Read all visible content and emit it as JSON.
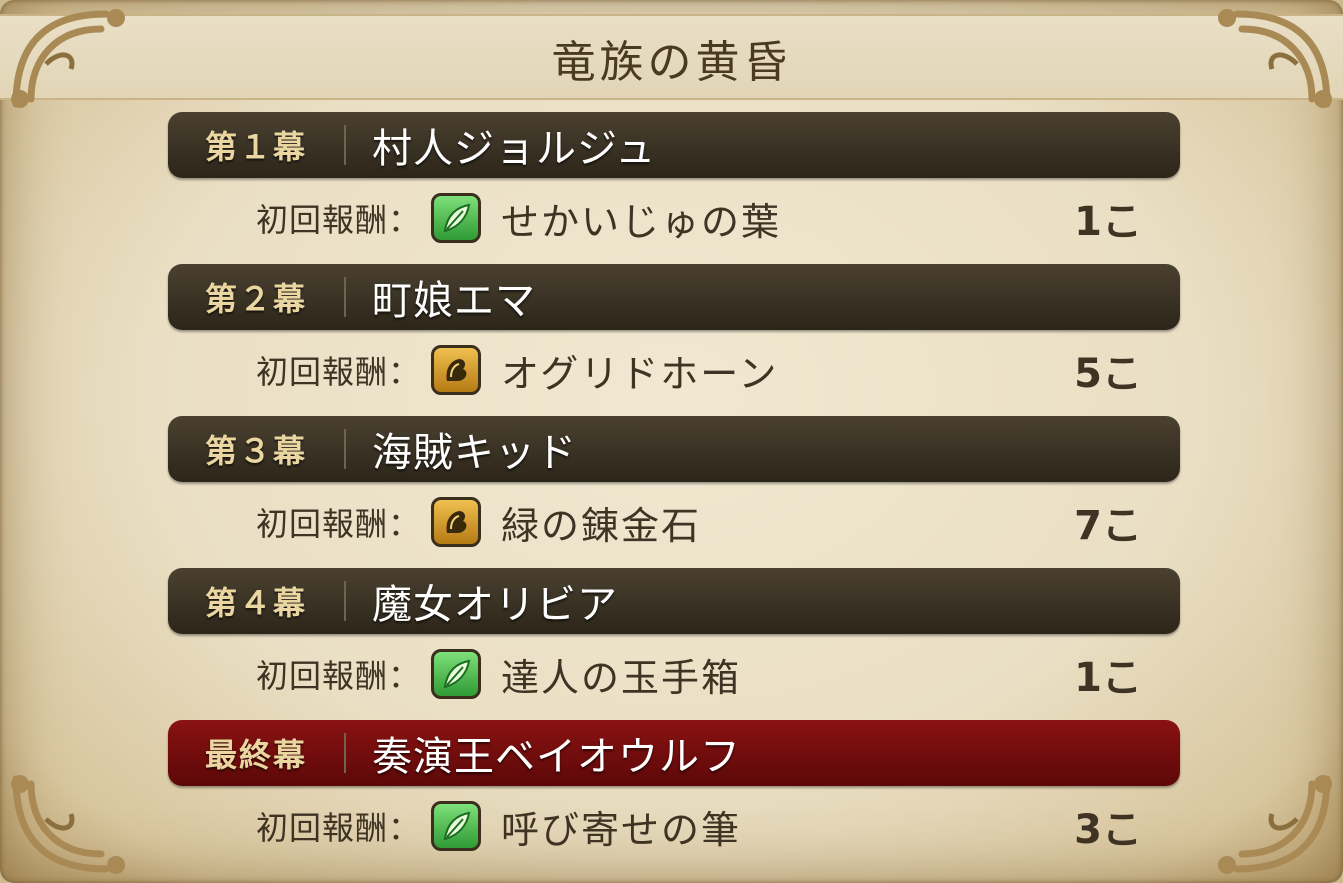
{
  "title": "竜族の黄昏",
  "reward_label": "初回報酬：",
  "colors": {
    "chapter_bar": "#2c2519",
    "final_bar": "#6a0a0a",
    "background": "#eadfc4",
    "icon_leaf": "#3fae3f",
    "icon_horn": "#c98f1e"
  },
  "chapters": [
    {
      "act": "第１幕",
      "name": "村人ジョルジュ",
      "item": "せかいじゅの葉",
      "icon": "leaf-icon",
      "count": "1こ",
      "final": false
    },
    {
      "act": "第２幕",
      "name": "町娘エマ",
      "item": "オグリドホーン",
      "icon": "horn-icon",
      "count": "5こ",
      "final": false
    },
    {
      "act": "第３幕",
      "name": "海賊キッド",
      "item": "緑の錬金石",
      "icon": "horn-icon",
      "count": "7こ",
      "final": false
    },
    {
      "act": "第４幕",
      "name": "魔女オリビア",
      "item": "達人の玉手箱",
      "icon": "leaf-icon",
      "count": "1こ",
      "final": false
    },
    {
      "act": "最終幕",
      "name": "奏演王ベイオウルフ",
      "item": "呼び寄せの筆",
      "icon": "leaf-icon",
      "count": "3こ",
      "final": true
    }
  ]
}
